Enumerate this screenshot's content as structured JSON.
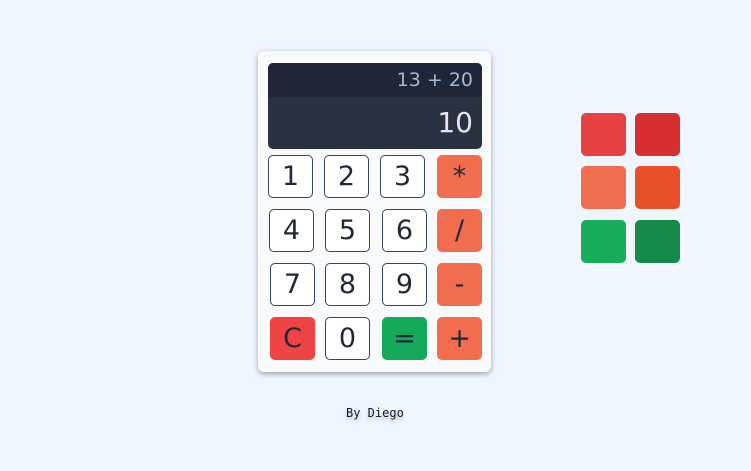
{
  "display": {
    "expression": "13 + 20",
    "result": "10"
  },
  "keys": {
    "one": "1",
    "two": "2",
    "three": "3",
    "multiply": "*",
    "four": "4",
    "five": "5",
    "six": "6",
    "divide": "/",
    "seven": "7",
    "eight": "8",
    "nine": "9",
    "subtract": "-",
    "clear": "C",
    "zero": "0",
    "equals": "=",
    "add": "+"
  },
  "palette": {
    "colors": [
      "#e84142",
      "#d72f30",
      "#f06d4f",
      "#e8502a",
      "#18ad5b",
      "#168a4a"
    ]
  },
  "footer": {
    "credit": "By Diego"
  }
}
